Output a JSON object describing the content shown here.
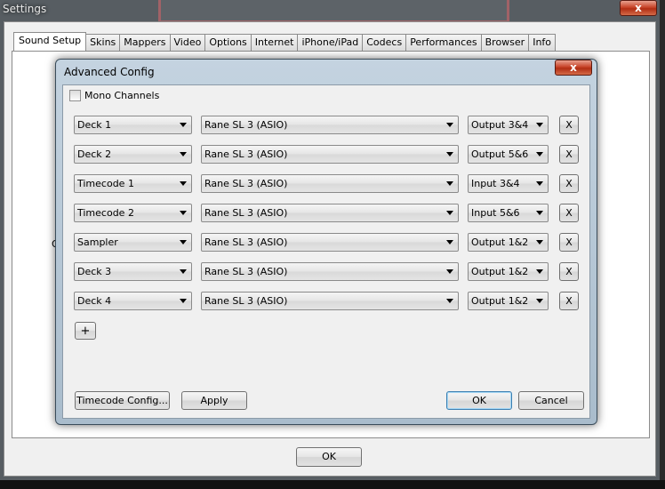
{
  "settings": {
    "title": "Settings",
    "close_label": "x",
    "tabs": [
      {
        "label": "Sound Setup",
        "active": true
      },
      {
        "label": "Skins"
      },
      {
        "label": "Mappers"
      },
      {
        "label": "Video"
      },
      {
        "label": "Options"
      },
      {
        "label": "Internet"
      },
      {
        "label": "iPhone/iPad"
      },
      {
        "label": "Codecs"
      },
      {
        "label": "Performances"
      },
      {
        "label": "Browser"
      },
      {
        "label": "Info"
      }
    ],
    "partial_label": "O",
    "ok_label": "OK"
  },
  "advanced": {
    "title": "Advanced Config",
    "close_label": "x",
    "mono_label": "Mono Channels",
    "mono_checked": false,
    "remove_label": "X",
    "rows": [
      {
        "channel": "Deck 1",
        "device": "Rane SL 3 (ASIO)",
        "route": "Output 3&4"
      },
      {
        "channel": "Deck 2",
        "device": "Rane SL 3 (ASIO)",
        "route": "Output 5&6"
      },
      {
        "channel": "Timecode 1",
        "device": "Rane SL 3 (ASIO)",
        "route": "Input 3&4"
      },
      {
        "channel": "Timecode 2",
        "device": "Rane SL 3 (ASIO)",
        "route": "Input 5&6"
      },
      {
        "channel": "Sampler",
        "device": "Rane SL 3 (ASIO)",
        "route": "Output 1&2"
      },
      {
        "channel": "Deck 3",
        "device": "Rane SL 3 (ASIO)",
        "route": "Output 1&2"
      },
      {
        "channel": "Deck 4",
        "device": "Rane SL 3 (ASIO)",
        "route": "Output 1&2"
      }
    ],
    "add_label": "+",
    "timecode_config_label": "Timecode Config...",
    "apply_label": "Apply",
    "ok_label": "OK",
    "cancel_label": "Cancel"
  },
  "colors": {
    "close_red": "#c8452a",
    "default_button_border": "#3c7fb1"
  }
}
